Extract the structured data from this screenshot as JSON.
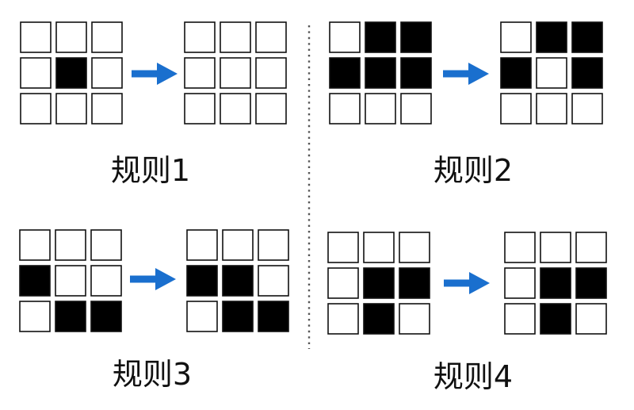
{
  "colors": {
    "filled": "#000000",
    "empty": "#ffffff",
    "stroke": "#111111",
    "arrow": "#1a6fce",
    "divider": "#555555"
  },
  "rules": [
    {
      "label": "规则1",
      "before": [
        0,
        0,
        0,
        0,
        1,
        0,
        0,
        0,
        0
      ],
      "after": [
        0,
        0,
        0,
        0,
        0,
        0,
        0,
        0,
        0
      ]
    },
    {
      "label": "规则2",
      "before": [
        0,
        1,
        1,
        1,
        1,
        1,
        0,
        0,
        0
      ],
      "after": [
        0,
        1,
        1,
        1,
        0,
        1,
        0,
        0,
        0
      ]
    },
    {
      "label": "规则3",
      "before": [
        0,
        0,
        0,
        1,
        0,
        0,
        0,
        1,
        1
      ],
      "after": [
        0,
        0,
        0,
        1,
        1,
        0,
        0,
        1,
        1
      ]
    },
    {
      "label": "规则4",
      "before": [
        0,
        0,
        0,
        0,
        1,
        1,
        0,
        1,
        0
      ],
      "after": [
        0,
        0,
        0,
        0,
        1,
        1,
        0,
        1,
        0
      ]
    }
  ]
}
